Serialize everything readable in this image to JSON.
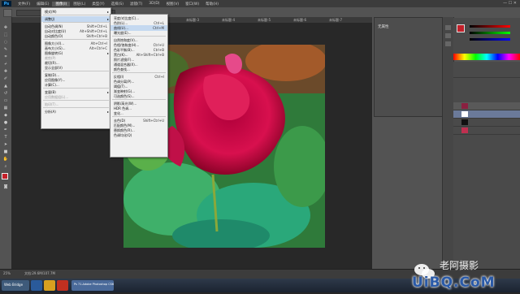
{
  "menubar": {
    "logo": "Ps",
    "items": [
      "文件(F)",
      "编辑(E)",
      "图像(I)",
      "图层(L)",
      "类型(Y)",
      "选择(S)",
      "滤镜(T)",
      "3D(D)",
      "视图(V)",
      "窗口(W)",
      "帮助(H)"
    ],
    "active_index": 2
  },
  "tabs": [
    "未标题-1",
    "未标题-2",
    "未标题-3",
    "未标题-4",
    "未标题-5",
    "未标题-6",
    "未标题-7"
  ],
  "image_menu": {
    "items": [
      {
        "label": "模式(M)",
        "shortcut": "",
        "sub": true
      },
      {
        "sep": true
      },
      {
        "label": "调整(J)",
        "shortcut": "",
        "sub": true,
        "hl": true
      },
      {
        "sep": true
      },
      {
        "label": "自动色调(N)",
        "shortcut": "Shift+Ctrl+L"
      },
      {
        "label": "自动对比度(U)",
        "shortcut": "Alt+Shift+Ctrl+L"
      },
      {
        "label": "自动颜色(O)",
        "shortcut": "Shift+Ctrl+B"
      },
      {
        "sep": true
      },
      {
        "label": "图像大小(I)...",
        "shortcut": "Alt+Ctrl+I"
      },
      {
        "label": "画布大小(S)...",
        "shortcut": "Alt+Ctrl+C"
      },
      {
        "label": "图像旋转(G)",
        "shortcut": "",
        "sub": true
      },
      {
        "label": "裁剪(P)",
        "shortcut": "",
        "dis": true
      },
      {
        "label": "裁切(R)...",
        "shortcut": ""
      },
      {
        "label": "显示全部(V)",
        "shortcut": ""
      },
      {
        "sep": true
      },
      {
        "label": "复制(D)...",
        "shortcut": ""
      },
      {
        "label": "应用图像(Y)...",
        "shortcut": ""
      },
      {
        "label": "计算(C)...",
        "shortcut": ""
      },
      {
        "sep": true
      },
      {
        "label": "变量(B)",
        "shortcut": "",
        "sub": true
      },
      {
        "label": "应用数据组(L)...",
        "shortcut": "",
        "dis": true
      },
      {
        "sep": true
      },
      {
        "label": "陷印(T)...",
        "shortcut": "",
        "dis": true
      },
      {
        "sep": true
      },
      {
        "label": "分析(A)",
        "shortcut": "",
        "sub": true
      }
    ]
  },
  "adjust_menu": {
    "items": [
      {
        "label": "亮度/对比度(C)...",
        "shortcut": ""
      },
      {
        "label": "色阶(L)...",
        "shortcut": "Ctrl+L"
      },
      {
        "label": "曲线(U)...",
        "shortcut": "Ctrl+M",
        "hl": true
      },
      {
        "label": "曝光度(E)...",
        "shortcut": ""
      },
      {
        "sep": true
      },
      {
        "label": "自然饱和度(V)...",
        "shortcut": ""
      },
      {
        "label": "色相/饱和度(H)...",
        "shortcut": "Ctrl+U"
      },
      {
        "label": "色彩平衡(B)...",
        "shortcut": "Ctrl+B"
      },
      {
        "label": "黑白(K)...",
        "shortcut": "Alt+Shift+Ctrl+B"
      },
      {
        "label": "照片滤镜(F)...",
        "shortcut": ""
      },
      {
        "label": "通道混合器(X)...",
        "shortcut": ""
      },
      {
        "label": "颜色查找...",
        "shortcut": ""
      },
      {
        "sep": true
      },
      {
        "label": "反相(I)",
        "shortcut": "Ctrl+I"
      },
      {
        "label": "色调分离(P)...",
        "shortcut": ""
      },
      {
        "label": "阈值(T)...",
        "shortcut": ""
      },
      {
        "label": "渐变映射(G)...",
        "shortcut": ""
      },
      {
        "label": "可选颜色(S)...",
        "shortcut": ""
      },
      {
        "sep": true
      },
      {
        "label": "阴影/高光(W)...",
        "shortcut": ""
      },
      {
        "label": "HDR 色调...",
        "shortcut": ""
      },
      {
        "label": "变化...",
        "shortcut": ""
      },
      {
        "sep": true
      },
      {
        "label": "去色(D)",
        "shortcut": "Shift+Ctrl+U"
      },
      {
        "label": "匹配颜色(M)...",
        "shortcut": ""
      },
      {
        "label": "替换颜色(R)...",
        "shortcut": ""
      },
      {
        "label": "色调均化(Q)",
        "shortcut": ""
      }
    ]
  },
  "adjust_panel": {
    "title": "无属性"
  },
  "statusbar": {
    "zoom": "25%",
    "doc": "文档:29.6M/107.7M"
  },
  "taskbar": {
    "start": "Web Bridge",
    "ps_task": "Ps 71.Adobe Photoshop CS6"
  },
  "watermark": {
    "wechat": "老阿摄影",
    "site": "UiBQ.CoM"
  },
  "colors": {
    "accent": "#31a8ff",
    "highlight": "#c5d9f0"
  }
}
